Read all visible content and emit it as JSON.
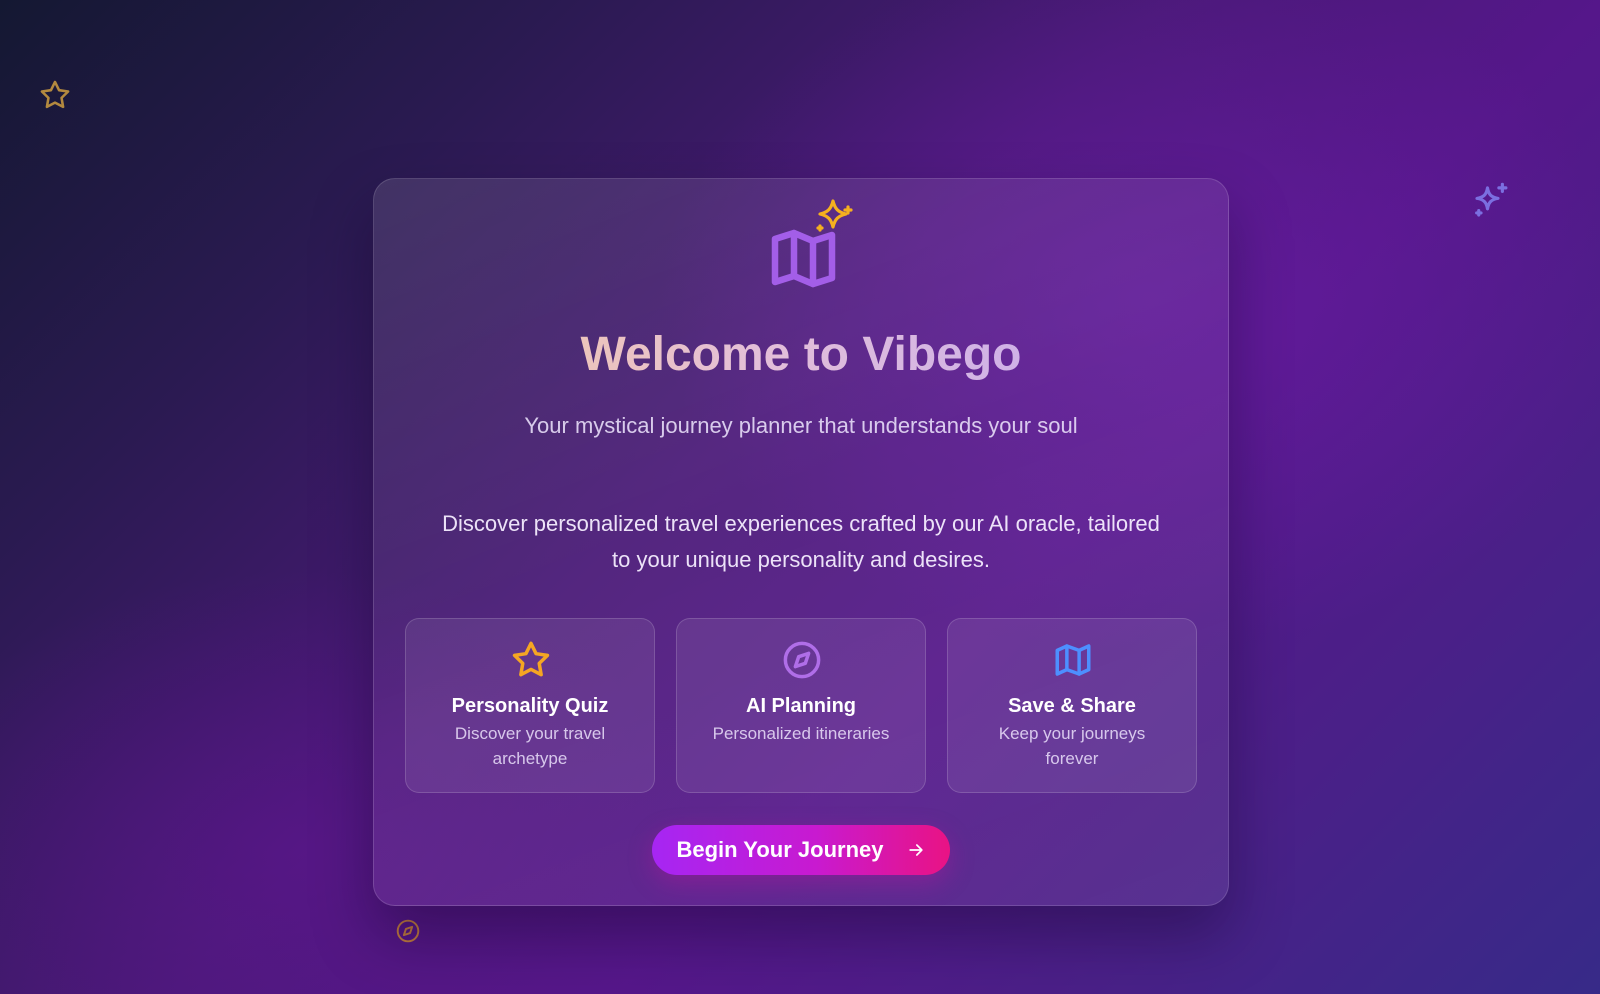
{
  "hero": {
    "title": "Welcome to Vibego",
    "subtitle": "Your mystical journey planner that understands your soul",
    "description": "Discover personalized travel experiences crafted by our AI oracle, tailored to your unique personality and desires."
  },
  "features": [
    {
      "icon": "star-icon",
      "title": "Personality Quiz",
      "description": "Discover your travel archetype",
      "accent": "#f5a623"
    },
    {
      "icon": "compass-icon",
      "title": "AI Planning",
      "description": "Personalized itineraries",
      "accent": "#b06ee8"
    },
    {
      "icon": "map-icon",
      "title": "Save & Share",
      "description": "Keep your journeys forever",
      "accent": "#4d8fff"
    }
  ],
  "cta": {
    "label": "Begin Your Journey",
    "icon": "arrow-right-icon"
  },
  "decorations": [
    "star-icon",
    "sparkles-icon",
    "compass-icon"
  ],
  "colors": {
    "logo_map": "#a35ee8",
    "logo_sparkle": "#f5b01f",
    "cta_start": "#a626f3",
    "cta_end": "#e91384",
    "deco_star": "#b3893f",
    "deco_sparkle": "#7b6fe0",
    "deco_compass": "#c07a3e"
  }
}
